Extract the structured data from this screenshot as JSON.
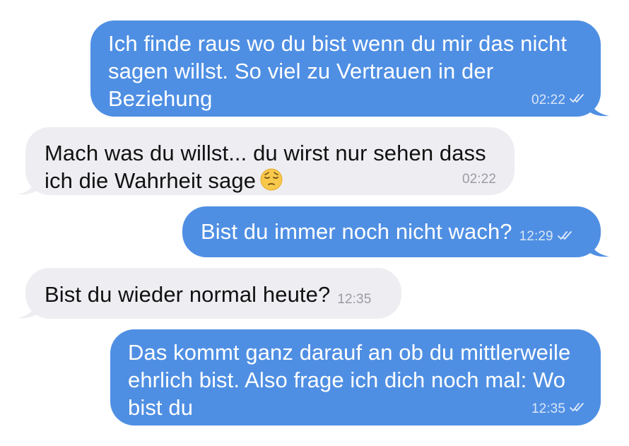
{
  "colors": {
    "outgoing_bubble": "#4f8fe3",
    "incoming_bubble": "#eeeef2",
    "outgoing_text": "#ffffff",
    "incoming_text": "#111111",
    "incoming_meta": "#9a9aa2"
  },
  "messages": [
    {
      "direction": "outgoing",
      "text": "Ich finde raus wo du bist wenn du mir das nicht\nsagen willst. So viel zu Vertrauen in der\nBeziehung",
      "time": "02:22",
      "status_icon": "double-check-icon"
    },
    {
      "direction": "incoming",
      "text": "Mach was du willst... du wirst nur sehen dass\nich die Wahrheit sage",
      "emoji": "pensive-face-emoji",
      "time": "02:22"
    },
    {
      "direction": "outgoing",
      "text": "Bist du immer noch nicht wach?",
      "time": "12:29",
      "status_icon": "double-check-icon"
    },
    {
      "direction": "incoming",
      "text": "Bist du wieder normal heute?",
      "time": "12:35"
    },
    {
      "direction": "outgoing",
      "text": "Das kommt ganz darauf an ob du mittlerweile\nehrlich bist. Also frage ich dich noch mal: Wo\nbist du",
      "time": "12:35",
      "status_icon": "double-check-icon"
    }
  ]
}
